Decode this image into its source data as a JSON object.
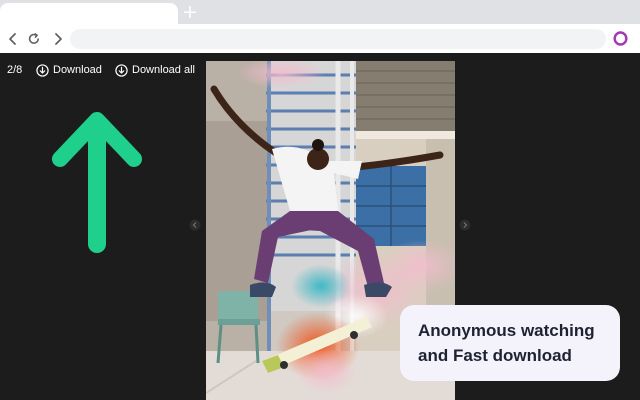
{
  "browser": {
    "new_tab_glyph": "+"
  },
  "viewer": {
    "counter": "2/8",
    "download_label": "Download",
    "download_all_label": "Download all"
  },
  "callout": {
    "line1": "Anonymous watching",
    "line2": "and Fast download"
  },
  "colors": {
    "arrow": "#1ed08c",
    "viewer_background": "#1c1c1c",
    "callout_background": "#f4f3fc",
    "opera_ring": "#a23ab2"
  },
  "icons": [
    "back-icon",
    "reload-icon",
    "forward-icon",
    "opera-icon",
    "download-icon",
    "download-all-icon",
    "up-arrow-icon",
    "prev-slide-icon",
    "next-slide-icon"
  ]
}
